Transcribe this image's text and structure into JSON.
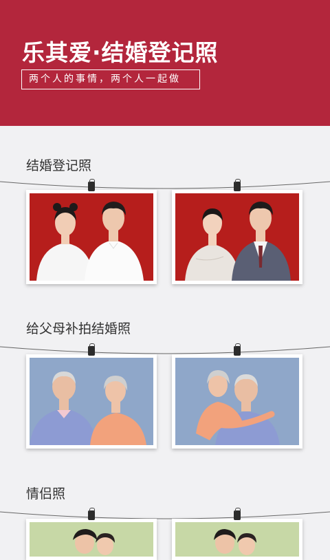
{
  "header": {
    "title": "乐其爱·结婚登记照",
    "subtitle": "两个人的事情，两个人一起做"
  },
  "sections": [
    {
      "title": "结婚登记照"
    },
    {
      "title": "给父母补拍结婚照"
    },
    {
      "title": "情侣照"
    }
  ],
  "colors": {
    "brand": "#b3263c",
    "photo_red": "#b61e1c",
    "photo_blue": "#8fa7c9",
    "photo_green": "#c7d8a6"
  },
  "icons": [
    "binder-clip-icon",
    "hanging-rope-icon"
  ]
}
